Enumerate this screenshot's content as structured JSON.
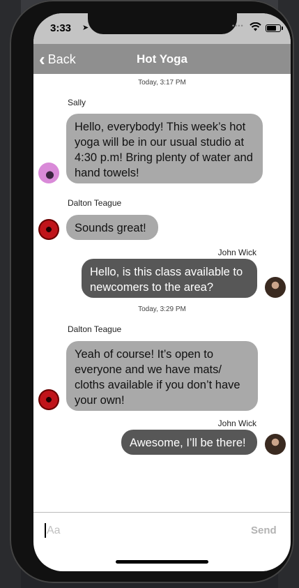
{
  "status": {
    "time": "3:33",
    "location_icon": "location-arrow-icon",
    "signal": "••••"
  },
  "nav": {
    "back_label": "Back",
    "title": "Hot Yoga"
  },
  "conversation": {
    "sections": [
      {
        "timestamp": "Today, 3:17 PM"
      },
      {
        "timestamp": "Today, 3:29 PM"
      }
    ],
    "messages": [
      {
        "sender": "Sally",
        "direction": "incoming",
        "text": "Hello, everybody! This week’s hot yoga will be in our usual studio at 4:30 p.m! Bring plenty of water and hand towels!",
        "avatar": "sally-avatar"
      },
      {
        "sender": "Dalton Teague",
        "direction": "incoming",
        "text": "Sounds great!",
        "avatar": "dalton-avatar"
      },
      {
        "sender": "John Wick",
        "direction": "outgoing",
        "text": "Hello, is this class available to newcomers to the area?",
        "avatar": "john-avatar"
      },
      {
        "sender": "Dalton Teague",
        "direction": "incoming",
        "text": "Yeah of course! It’s open to everyone and we have mats/ cloths available if you don’t have your own!",
        "avatar": "dalton-avatar"
      },
      {
        "sender": "John Wick",
        "direction": "outgoing",
        "text": "Awesome, I’ll be there!",
        "avatar": "john-avatar"
      }
    ]
  },
  "composer": {
    "placeholder": "Aa",
    "send_label": "Send"
  },
  "colors": {
    "incoming_bubble": "#a9a9a9",
    "outgoing_bubble": "#575757",
    "nav_bar": "#8f8f8f"
  }
}
